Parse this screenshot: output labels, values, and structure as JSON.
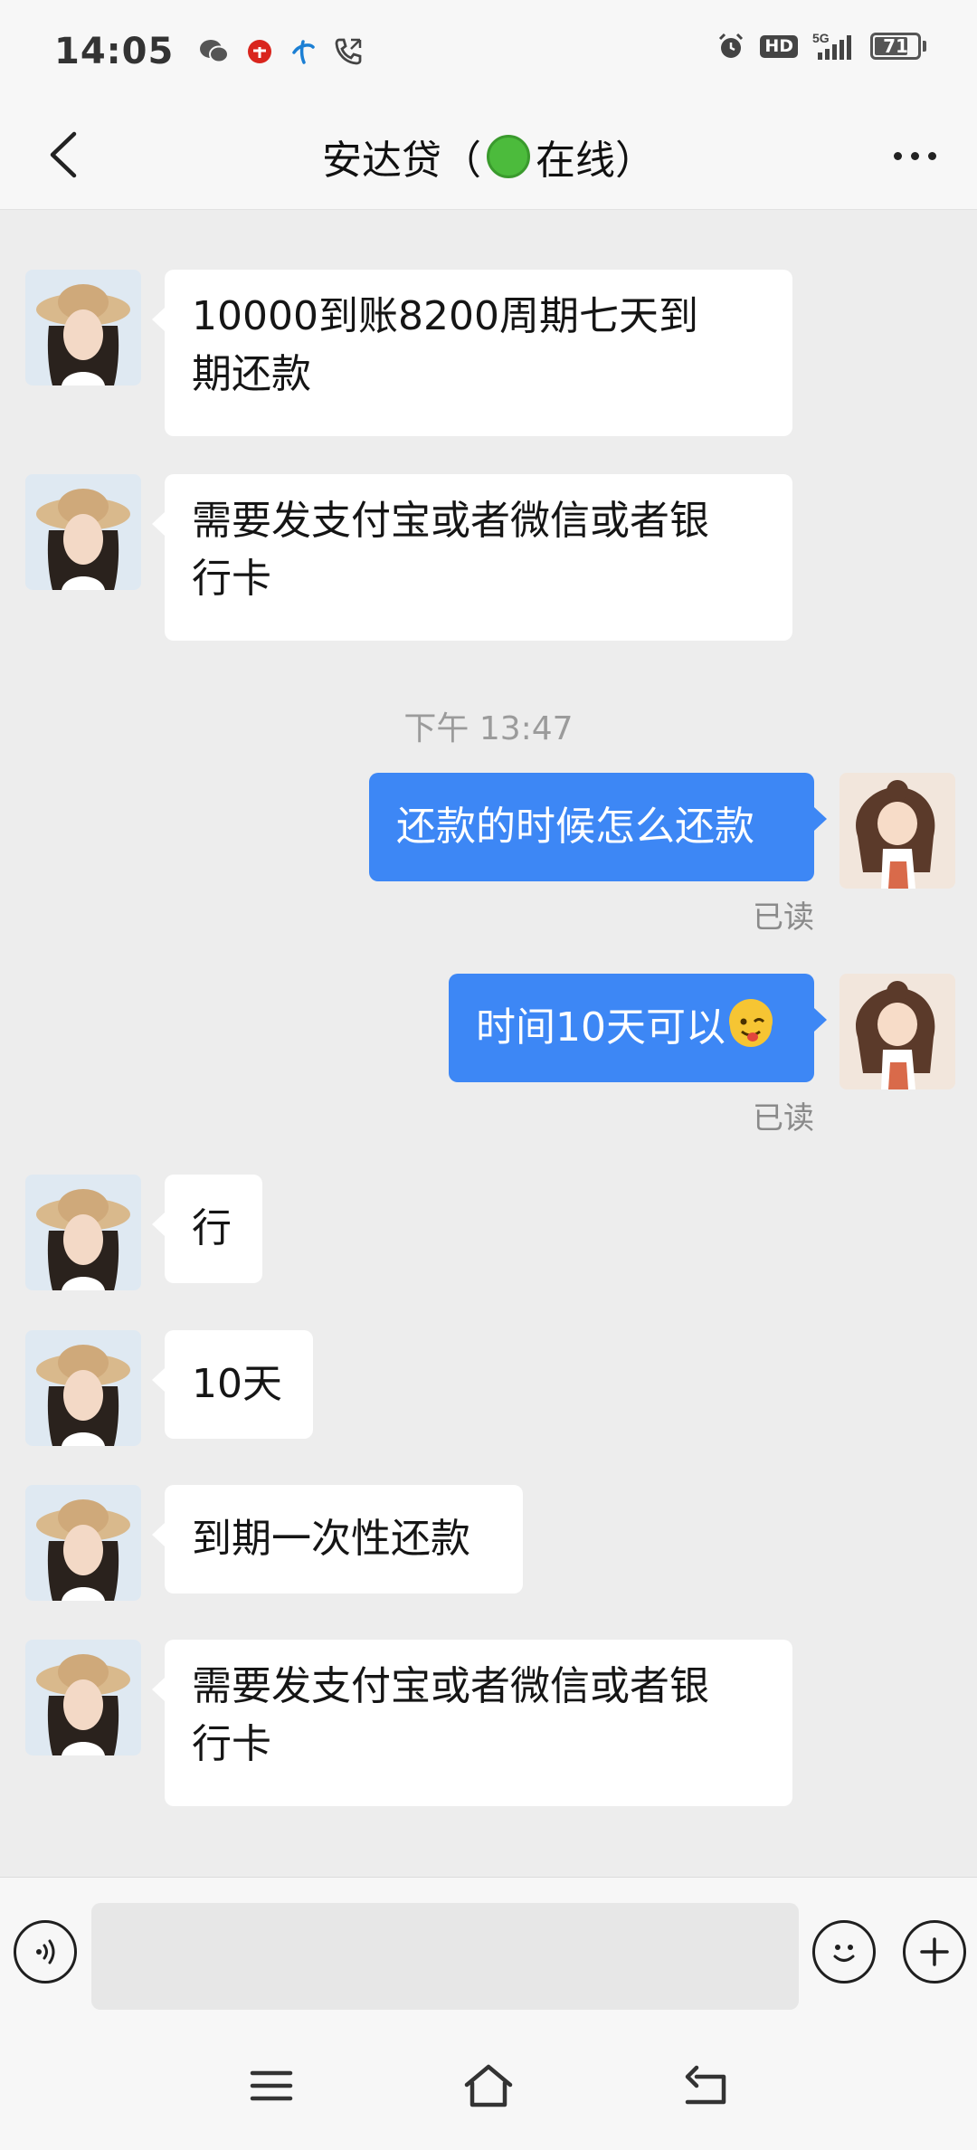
{
  "status_bar": {
    "time": "14:05",
    "icons": [
      "wechat-icon",
      "app-icon",
      "telecom-icon",
      "call-icon",
      "alarm-icon",
      "hd-icon",
      "signal-5g-icon",
      "battery-icon"
    ],
    "hd_label": "HD",
    "network_label": "5G",
    "battery_level": "71"
  },
  "header": {
    "title": "安达贷（",
    "status": "在线）",
    "back_icon": "chevron-left-icon",
    "more_icon": "more-dots-icon"
  },
  "messages": [
    {
      "side": "in",
      "text": "10000到账8200周期七天到\n期还款"
    },
    {
      "side": "in",
      "text": "需要发支付宝或者微信或者银\n行卡"
    },
    {
      "timestamp": "下午 13:47"
    },
    {
      "side": "out",
      "text": "还款的时候怎么还款",
      "receipt": "已读"
    },
    {
      "side": "out",
      "text": "时间10天可以",
      "emoji": "winking-face-tongue-icon",
      "receipt": "已读"
    },
    {
      "side": "in",
      "text": "行"
    },
    {
      "side": "in",
      "text": "10天"
    },
    {
      "side": "in",
      "text": "到期一次性还款"
    },
    {
      "side": "in",
      "text": "需要发支付宝或者微信或者银\n行卡"
    }
  ],
  "input_bar": {
    "placeholder": "",
    "voice_icon": "voice-icon",
    "emoji_icon": "smiley-icon",
    "plus_icon": "plus-icon"
  },
  "nav_bar": {
    "icons": [
      "menu-icon",
      "home-icon",
      "back-icon"
    ]
  }
}
